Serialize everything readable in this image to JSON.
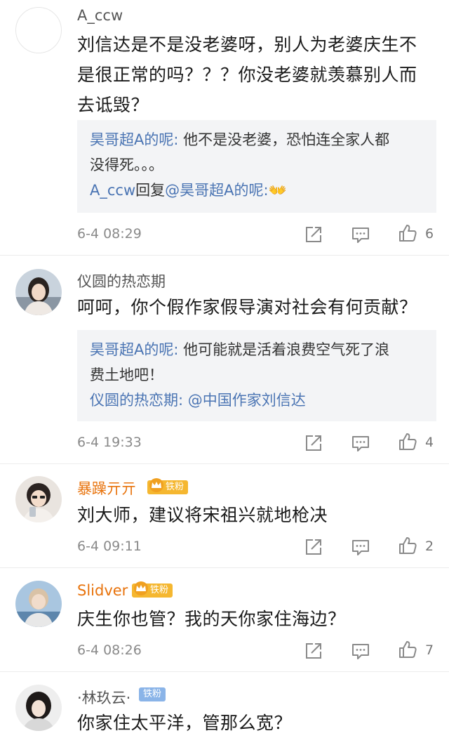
{
  "comments": [
    {
      "username": "A_ccw",
      "text_lines": [
        "刘信达是不是没老婆呀，别人为老婆庆生不",
        "是很正常的吗？？？你没老婆就羡慕别人而",
        "去诋毁？"
      ],
      "replies": [
        {
          "name": "昊哥超A的呢:",
          "lines": [
            " 他不是没老婆，恐怕连全家人都",
            "没得死。。。"
          ]
        },
        {
          "name": "A_ccw",
          "lines": [
            "回复",
            "@昊哥超A的呢:",
            "👐"
          ]
        }
      ],
      "time": "6-4 08:29",
      "likes": "6"
    },
    {
      "username": "仪圆的热恋期",
      "text_lines": [
        "呵呵，你个假作家假导演对社会有何贡献？"
      ],
      "replies": [
        {
          "name": "昊哥超A的呢:",
          "lines": [
            " 他可能就是活着浪费空气死了浪",
            "费土地吧！"
          ]
        },
        {
          "name": "仪圆的热恋期:",
          "lines": [
            " @中国作家刘信达"
          ]
        }
      ],
      "time": "6-4 19:33",
      "likes": "4"
    },
    {
      "username": "暴躁亓亓",
      "badge": "铁粉",
      "text_lines": [
        "刘大师，建议将宋祖兴就地枪决"
      ],
      "time": "6-4 09:11",
      "likes": "2"
    },
    {
      "username": "Slidver",
      "badge": "铁粉",
      "text_lines": [
        "庆生你也管？我的天你家住海边？"
      ],
      "time": "6-4 08:26",
      "likes": "7"
    },
    {
      "username": "·林玖云·",
      "badge": "铁粉",
      "text_lines": [
        "你家住太平洋，管那么宽？"
      ]
    }
  ],
  "icons": {
    "share": "share-icon",
    "comment": "comment-icon",
    "like": "like-icon"
  },
  "colors": {
    "link": "#4a74b3",
    "orange_name": "#e8730c",
    "badge_gold": "#f5b730",
    "badge_blue": "#8ab4e8"
  }
}
